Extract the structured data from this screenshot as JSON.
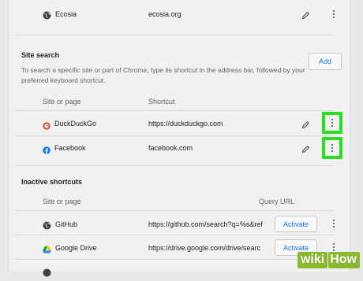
{
  "top_row": {
    "name": "Ecosia",
    "url": "ecosia.org"
  },
  "site_search": {
    "title": "Site search",
    "description_line1": "To search a specific site or part of Chrome, type its shortcut in the address bar, followed by your",
    "description_line2": "preferred keyboard shortcut.",
    "add_label": "Add",
    "col_site": "Site or page",
    "col_shortcut": "Shortcut",
    "rows": [
      {
        "name": "DuckDuckGo",
        "shortcut": "https://duckduckgo.com"
      },
      {
        "name": "Facebook",
        "shortcut": "facebook.com"
      }
    ]
  },
  "inactive": {
    "title": "Inactive shortcuts",
    "col_site": "Site or page",
    "col_query": "Query URL",
    "activate_label": "Activate",
    "rows": [
      {
        "name": "GitHub",
        "url": "https://github.com/search?q=%s&ref"
      },
      {
        "name": "Google Drive",
        "url": "https://drive.google.com/drive/searc"
      }
    ]
  },
  "colors": {
    "highlight": "#2bdc1f",
    "accent": "#1a73e8",
    "watermark": "#8bb92e"
  },
  "watermark": {
    "wiki": "wiki",
    "how": "How"
  }
}
